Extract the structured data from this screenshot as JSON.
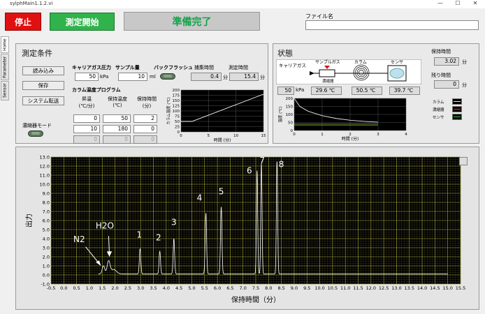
{
  "window": {
    "title": "sylphMain1.1.2.vi",
    "minimize": "—",
    "maximize": "☐",
    "close": "✕"
  },
  "toolbar": {
    "stop_label": "停止",
    "start_label": "測定開始",
    "status_text": "準備完了",
    "file_label": "ファイル名",
    "file_value": ""
  },
  "tabs": [
    "Home",
    "Parameter",
    "Sensor"
  ],
  "conditions": {
    "title": "測定条件",
    "load_label": "読み込み",
    "save_label": "保存",
    "transfer_label": "システム転送",
    "concentrator_label": "濃縮器モード",
    "carrier_pressure_label": "キャリアガス圧力",
    "carrier_pressure_value": "50",
    "carrier_pressure_unit": "kPa",
    "sample_label": "サンプル量",
    "sample_value": "10",
    "sample_unit": "ml",
    "backflush_label": "バックフラッシュ",
    "collect_time_label": "捕集時間",
    "collect_time_value": "0.4",
    "collect_time_unit": "分",
    "measure_time_label": "測定時間",
    "measure_time_value": "15.4",
    "measure_time_unit": "分",
    "program_label": "カラム温度プログラム",
    "col_rate": "昇温\n(℃/分)",
    "col_temp": "保持温度\n(℃)",
    "col_hold": "保持時間\n(分)",
    "rows": [
      [
        "0",
        "50",
        "2"
      ],
      [
        "10",
        "180",
        "0"
      ],
      [
        "0",
        "0",
        "0"
      ]
    ]
  },
  "status": {
    "title": "状態",
    "carrier_label": "キャリアガス",
    "sample_gas_label": "サンプルガス",
    "concentrator_label": "濃縮器",
    "column_label": "カラム",
    "sensor_label": "センサ",
    "pressure_value": "50",
    "pressure_unit": "kPa",
    "temp1_value": "29.6",
    "temp2_value": "50.5",
    "temp3_value": "39.7",
    "temp_unit": "℃",
    "retention_label": "保持時間",
    "retention_value": "3.02",
    "retention_unit": "分",
    "remaining_label": "残り時間",
    "remaining_value": "0",
    "remaining_unit": "分",
    "legend": [
      "カラム",
      "濃縮器",
      "センサ"
    ]
  },
  "chart_data": [
    {
      "type": "line",
      "title": "",
      "xlabel": "時間 (分)",
      "ylabel": "カラム温度 (℃)",
      "xlim": [
        0,
        15
      ],
      "ylim": [
        0,
        200
      ],
      "xticks": [
        0,
        5,
        10,
        15
      ],
      "yticks": [
        0,
        25,
        50,
        75,
        100,
        125,
        150,
        175,
        200
      ],
      "x": [
        0,
        2,
        15
      ],
      "values": [
        50,
        50,
        180
      ],
      "colors": {
        "background": "#000000",
        "line": "#ffffff",
        "grid": "#555555"
      }
    },
    {
      "type": "line",
      "title": "",
      "xlabel": "時間 (分)",
      "ylabel": "温度 (℃)",
      "xlim": [
        0,
        4
      ],
      "ylim": [
        0,
        200
      ],
      "xticks": [
        0,
        1,
        2,
        3,
        4
      ],
      "yticks": [
        0,
        50,
        100,
        150,
        200
      ],
      "legend": "right",
      "series": [
        {
          "name": "カラム",
          "color": "#e8e8e8",
          "x": [
            0,
            0.2,
            0.5,
            1,
            1.5,
            2,
            2.5,
            3
          ],
          "values": [
            200,
            150,
            120,
            92,
            75,
            64,
            57,
            52
          ]
        },
        {
          "name": "濃縮器",
          "color": "#ff2a2a",
          "x": [
            0,
            3
          ],
          "values": [
            33,
            33
          ]
        },
        {
          "name": "センサ",
          "color": "#2fd12f",
          "x": [
            0,
            3
          ],
          "values": [
            40,
            40
          ]
        }
      ]
    },
    {
      "type": "line",
      "title": "",
      "xlabel": "保持時間（分）",
      "ylabel": "出力",
      "xlim": [
        -0.5,
        15.5
      ],
      "ylim": [
        -1.0,
        13.0
      ],
      "xticks": [
        "-0.5",
        "0.0",
        "0.5",
        "1.0",
        "1.5",
        "2.0",
        "2.5",
        "3.0",
        "3.5",
        "4.0",
        "4.5",
        "5.0",
        "5.5",
        "6.0",
        "6.5",
        "7.0",
        "7.5",
        "8.0",
        "8.5",
        "9.0",
        "9.5",
        "10.0",
        "10.5",
        "11.0",
        "11.5",
        "12.0",
        "12.5",
        "13.0",
        "13.5",
        "14.0",
        "14.5",
        "15.0",
        "15.5"
      ],
      "yticks": [
        "-1.0",
        "0.0",
        "1.0",
        "2.0",
        "3.0",
        "4.0",
        "5.0",
        "6.0",
        "7.0",
        "8.0",
        "9.0",
        "10.0",
        "11.0",
        "12.0",
        "13.0"
      ],
      "peaks": [
        {
          "x": 1.55,
          "h": 0.9,
          "w": 0.07
        },
        {
          "x": 1.75,
          "h": 1.4,
          "w": 0.08
        },
        {
          "x": 1.95,
          "h": 0.5,
          "w": 0.15
        },
        {
          "x": 2.98,
          "h": 2.8,
          "w": 0.04
        },
        {
          "x": 3.75,
          "h": 2.5,
          "w": 0.04
        },
        {
          "x": 4.3,
          "h": 3.9,
          "w": 0.04
        },
        {
          "x": 5.55,
          "h": 6.7,
          "w": 0.04
        },
        {
          "x": 6.15,
          "h": 7.4,
          "w": 0.04
        },
        {
          "x": 7.55,
          "h": 11.4,
          "w": 0.035
        },
        {
          "x": 7.72,
          "h": 12.2,
          "w": 0.035
        },
        {
          "x": 8.33,
          "h": 12.4,
          "w": 0.035
        }
      ],
      "annotations": [
        {
          "text": "N2",
          "x": 0.6,
          "y": 3.6
        },
        {
          "text": "H2O",
          "x": 1.6,
          "y": 5.1
        },
        {
          "text": "1",
          "x": 2.95,
          "y": 4.1
        },
        {
          "text": "2",
          "x": 3.7,
          "y": 3.8
        },
        {
          "text": "3",
          "x": 4.3,
          "y": 5.5
        },
        {
          "text": "4",
          "x": 5.3,
          "y": 8.2
        },
        {
          "text": "5",
          "x": 6.15,
          "y": 8.9
        },
        {
          "text": "6",
          "x": 7.25,
          "y": 11.2
        },
        {
          "text": "7",
          "x": 7.75,
          "y": 12.3
        },
        {
          "text": "8",
          "x": 8.5,
          "y": 11.9
        }
      ],
      "colors": {
        "background": "#000000",
        "trace": "#ffffff",
        "grid": "#a8a83a",
        "minor_grid": "#3c3c20"
      }
    }
  ]
}
